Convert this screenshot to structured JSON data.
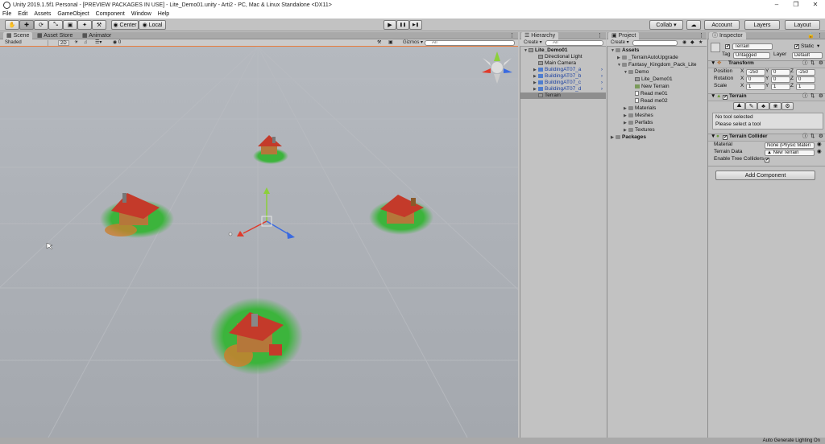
{
  "window": {
    "title": "Unity 2019.1.5f1 Personal - [PREVIEW PACKAGES IN USE] - Lite_Demo01.unity - Arti2 - PC, Mac & Linux Standalone <DX11>",
    "minimize": "–",
    "maximize": "❐",
    "close": "✕"
  },
  "menu": [
    "File",
    "Edit",
    "Assets",
    "GameObject",
    "Component",
    "Window",
    "Help"
  ],
  "toolbar": {
    "tools": [
      "hand-tool",
      "move-tool",
      "rotate-tool",
      "scale-tool",
      "rect-tool",
      "transform-tool",
      "custom-tool"
    ],
    "tool_glyphs": [
      "✋",
      "✚",
      "⟳",
      "⤡",
      "▣",
      "✦",
      "⚒"
    ],
    "pivot": "Center",
    "space": "Local",
    "play": "▶",
    "pause": "❚❚",
    "step": "▶❚",
    "collab": "Collab ▾",
    "account": "Account",
    "layers": "Layers",
    "layout": "Layout"
  },
  "scene_panel": {
    "tabs": [
      "Scene",
      "Asset Store",
      "Animator"
    ],
    "shading": "Shaded",
    "mode_2d": "2D",
    "fx_count": "0",
    "gizmos": "Gizmos ▾",
    "search_placeholder": "All"
  },
  "hierarchy": {
    "tab": "Hierarchy",
    "create": "Create ▾",
    "search_placeholder": "All",
    "scene": "Lite_Demo01",
    "items": [
      {
        "label": "Directional Light",
        "type": "go"
      },
      {
        "label": "Main Camera",
        "type": "go"
      },
      {
        "label": "BuildingAT07_a",
        "type": "prefab"
      },
      {
        "label": "BuildingAT07_b",
        "type": "prefab"
      },
      {
        "label": "BuildingAT07_c",
        "type": "prefab"
      },
      {
        "label": "BuildingAT07_d",
        "type": "prefab"
      },
      {
        "label": "Terrain",
        "type": "selected"
      }
    ]
  },
  "project": {
    "tab": "Project",
    "create": "Create ▾",
    "items": [
      {
        "label": "Assets",
        "depth": 0,
        "kind": "folder",
        "bold": true
      },
      {
        "label": "_TerrainAutoUpgrade",
        "depth": 1,
        "kind": "folder"
      },
      {
        "label": "Fantasy_Kingdom_Pack_Lite",
        "depth": 1,
        "kind": "folder"
      },
      {
        "label": "Demo",
        "depth": 2,
        "kind": "folder"
      },
      {
        "label": "Lite_Demo01",
        "depth": 3,
        "kind": "unity"
      },
      {
        "label": "New Terrain",
        "depth": 3,
        "kind": "terrain"
      },
      {
        "label": "Read me01",
        "depth": 3,
        "kind": "doc"
      },
      {
        "label": "Read me02",
        "depth": 3,
        "kind": "doc"
      },
      {
        "label": "Materials",
        "depth": 2,
        "kind": "folder"
      },
      {
        "label": "Meshes",
        "depth": 2,
        "kind": "folder"
      },
      {
        "label": "Perfabs",
        "depth": 2,
        "kind": "folder"
      },
      {
        "label": "Textures",
        "depth": 2,
        "kind": "folder"
      },
      {
        "label": "Packages",
        "depth": 0,
        "kind": "folder",
        "bold": true
      }
    ]
  },
  "inspector": {
    "tab": "Inspector",
    "object_name": "Terrain",
    "static_label": "Static",
    "tag_label": "Tag",
    "tag_value": "Untagged",
    "layer_label": "Layer",
    "layer_value": "Default",
    "transform": {
      "title": "Transform",
      "position_label": "Position",
      "rotation_label": "Rotation",
      "scale_label": "Scale",
      "position": [
        "-250",
        "0",
        "-250"
      ],
      "rotation": [
        "0",
        "0",
        "0"
      ],
      "scale": [
        "1",
        "1",
        "1"
      ],
      "axes": [
        "X",
        "Y",
        "Z"
      ]
    },
    "terrain": {
      "title": "Terrain",
      "no_tool": "No tool selected",
      "please_select": "Please select a tool",
      "tool_glyphs": [
        "⛰",
        "✎",
        "♣",
        "❀",
        "⚙"
      ]
    },
    "terrain_collider": {
      "title": "Terrain Collider",
      "material_label": "Material",
      "material_value": "None (Physic Materi",
      "terrain_data_label": "Terrain Data",
      "terrain_data_value": "New Terrain",
      "enable_trees_label": "Enable Tree Colliders",
      "enable_trees_checked": "✔"
    },
    "add_component": "Add Component"
  },
  "status": "Auto Generate Lighting On",
  "colors": {
    "accent_orange": "#e87c3e",
    "selection_blue": "#1a3fa0",
    "grass_green": "#3cb43c",
    "roof_red": "#c43a2a",
    "gizmo_x": "#e03a2a",
    "gizmo_y": "#8cd03a",
    "gizmo_z": "#3a6ae0"
  }
}
